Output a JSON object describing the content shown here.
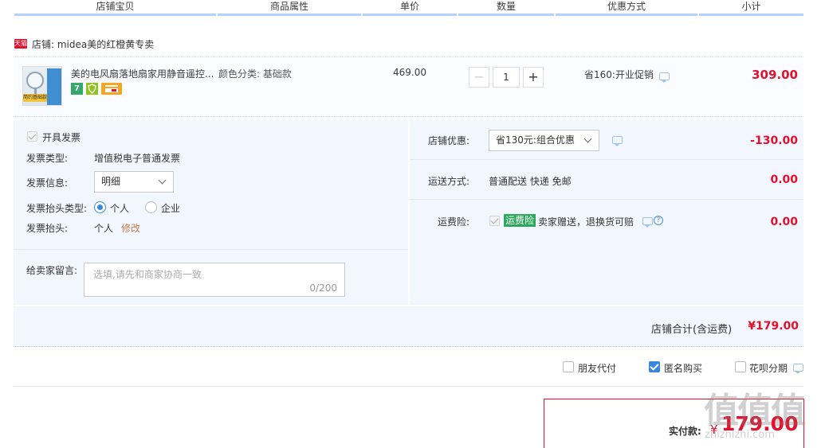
{
  "columns": [
    "店铺宝贝",
    "商品属性",
    "单价",
    "数量",
    "优惠方式",
    "小计"
  ],
  "store": {
    "badge": "天猫",
    "label": "店铺: midea美的红橙黄专卖"
  },
  "item": {
    "title": "美的电风扇落地扇家用静音遥控...",
    "thumbnail_text": "简约基础款",
    "attribute": "颜色分类: 基础款",
    "unit_price": "469.00",
    "quantity": "1",
    "qty_minus": "−",
    "qty_plus": "+",
    "discount": "省160:开业促销",
    "subtotal": "309.00",
    "service_icons": [
      {
        "name": "7",
        "color": "#35a96a"
      },
      {
        "name": "shield",
        "color": "#8fc31f"
      },
      {
        "name": "card",
        "color": "#f6a623"
      }
    ]
  },
  "invoice": {
    "toggle_label": "开具发票",
    "type_label": "发票类型:",
    "type_value": "增值税电子普通发票",
    "info_label": "发票信息:",
    "info_value": "明细",
    "header_type_label": "发票抬头类型:",
    "header_type_options": [
      "个人",
      "企业"
    ],
    "header_label": "发票抬头:",
    "header_value": "个人",
    "edit_link": "修改"
  },
  "message": {
    "label": "给卖家留言:",
    "placeholder": "选填,请先和商家协商一致",
    "counter": "0/200"
  },
  "shop_discount": {
    "label": "店铺优惠:",
    "value": "省130元:组合优惠",
    "amount": "-130.00"
  },
  "shipping": {
    "label": "运送方式:",
    "value": "普通配送 快递 免邮",
    "amount": "0.00"
  },
  "freight_insurance": {
    "label": "运费险:",
    "tag": "运费险",
    "desc": "卖家赠送，退换货可赔",
    "amount": "0.00"
  },
  "store_total": {
    "label": "店铺合计(含运费)",
    "amount": "¥179.00"
  },
  "options": {
    "friend_pay": "朋友代付",
    "anonymous": "匿名购买",
    "huabei": "花呗分期"
  },
  "payment": {
    "label": "实付款:",
    "currency": "¥",
    "amount": "179.00"
  },
  "watermark": {
    "big": "值值值",
    "small": "zhizhizhi.com"
  },
  "colors": {
    "accent_red": "#e5102b",
    "accent_blue": "#3a86de",
    "panel_bg": "#f2f7ff"
  }
}
